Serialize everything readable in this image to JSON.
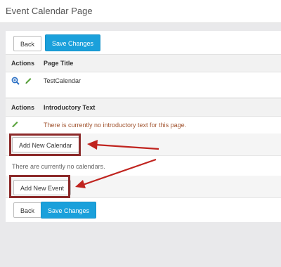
{
  "window": {
    "title": "Event Calendar Page"
  },
  "top_toolbar": {
    "back_label": "Back",
    "save_label": "Save Changes"
  },
  "page_title_section": {
    "actions_header": "Actions",
    "column_header": "Page Title",
    "value": "TestCalendar"
  },
  "intro_section": {
    "actions_header": "Actions",
    "column_header": "Introductory Text",
    "empty_message": "There is currently no introductory text for this page."
  },
  "calendars": {
    "add_label": "Add New Calendar",
    "empty_message": "There are currently no calendars."
  },
  "events": {
    "add_label": "Add New Event"
  },
  "bottom_toolbar": {
    "back_label": "Back",
    "save_label": "Save Changes"
  },
  "colors": {
    "primary": "#1aa0db",
    "warning_text": "#a0522d",
    "annotation": "#c0241f"
  },
  "icons": [
    "zoom-in-icon",
    "pencil-icon"
  ]
}
